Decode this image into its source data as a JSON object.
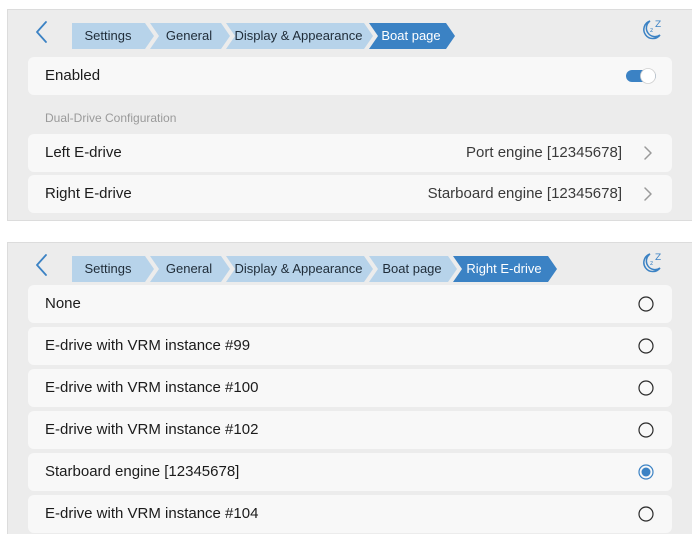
{
  "top_panel": {
    "breadcrumbs": [
      "Settings",
      "General",
      "Display & Appearance",
      "Boat page"
    ],
    "rows": {
      "enabled": {
        "label": "Enabled",
        "toggle_state": "on"
      },
      "section_header": "Dual-Drive Configuration",
      "left_edrive": {
        "label": "Left E-drive",
        "value": "Port engine [12345678]"
      },
      "right_edrive": {
        "label": "Right E-drive",
        "value": "Starboard engine [12345678]"
      }
    }
  },
  "bottom_panel": {
    "breadcrumbs": [
      "Settings",
      "General",
      "Display & Appearance",
      "Boat page",
      "Right E-drive"
    ],
    "options": [
      {
        "label": "None",
        "selected": false
      },
      {
        "label": "E-drive with VRM instance #99",
        "selected": false
      },
      {
        "label": "E-drive with VRM instance #100",
        "selected": false
      },
      {
        "label": "E-drive with VRM instance #102",
        "selected": false
      },
      {
        "label": "Starboard engine [12345678]",
        "selected": true
      },
      {
        "label": "E-drive with VRM instance #104",
        "selected": false
      }
    ]
  },
  "icons": {
    "back": "chevron-left-icon",
    "sleep": "sleep-icon",
    "chevron": "chevron-right-icon",
    "radio": "radio-button-icon",
    "toggle": "toggle-switch-icon"
  },
  "colors": {
    "accent": "#3b82c4",
    "crumb_inactive": "#b7d3ea",
    "panel_bg": "#ececec",
    "row_bg": "#f8f8f8"
  }
}
